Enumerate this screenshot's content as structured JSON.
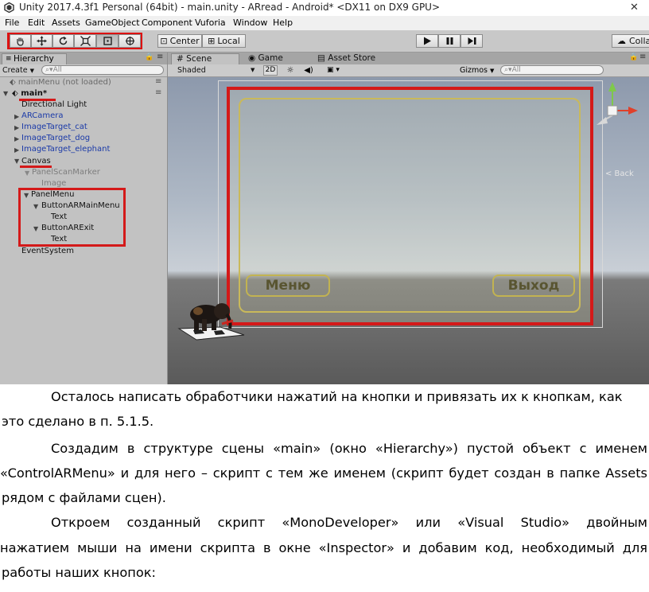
{
  "window": {
    "title": "Unity 2017.4.3f1 Personal (64bit) - main.unity - ARread - Android* <DX11 on DX9 GPU>",
    "close_glyph": "✕"
  },
  "menubar": [
    "File",
    "Edit",
    "Assets",
    "GameObject",
    "Component",
    "Vuforia",
    "Window",
    "Help"
  ],
  "toolbar": {
    "center": "Center",
    "local": "Local",
    "collab": "Colla"
  },
  "hierarchy": {
    "tab": "Hierarchy",
    "create": "Create",
    "search_placeholder": "All",
    "items": [
      "mainMenu (not loaded)",
      "main*",
      "Directional Light",
      "ARCamera",
      "ImageTarget_cat",
      "ImageTarget_dog",
      "ImageTarget_elephant",
      "Canvas",
      "PanelScanMarker",
      "Image",
      "PanelMenu",
      "ButtonARMainMenu",
      "Text",
      "ButtonARExit",
      "Text",
      "EventSystem"
    ]
  },
  "scene": {
    "tabs": [
      "Scene",
      "Game",
      "Asset Store"
    ],
    "shading": "Shaded",
    "mode_2d": "2D",
    "gizmos": "Gizmos",
    "search_placeholder": "All",
    "menu_button": "Меню",
    "exit_button": "Выход",
    "back_label": "< Back"
  },
  "document": {
    "paragraphs": [
      [
        "Осталось написать обработчики нажатий на кнопки и привязать их к кнопкам, как",
        "это сделано в п. 5.1.5."
      ],
      [
        "Создадим в структуре сцены «main» (окно «Hierarchy») пустой объект с именем",
        "«ControlARMenu» и для него – скрипт с тем же именем (скрипт будет создан в папке Assets",
        "рядом с файлами сцен)."
      ],
      [
        "Откроем созданный скрипт «MonoDeveloper» или «Visual Studio» двойным",
        "нажатием мыши на имени скрипта в окне «Inspector» и добавим код, необходимый для",
        "работы наших кнопок:"
      ]
    ]
  }
}
